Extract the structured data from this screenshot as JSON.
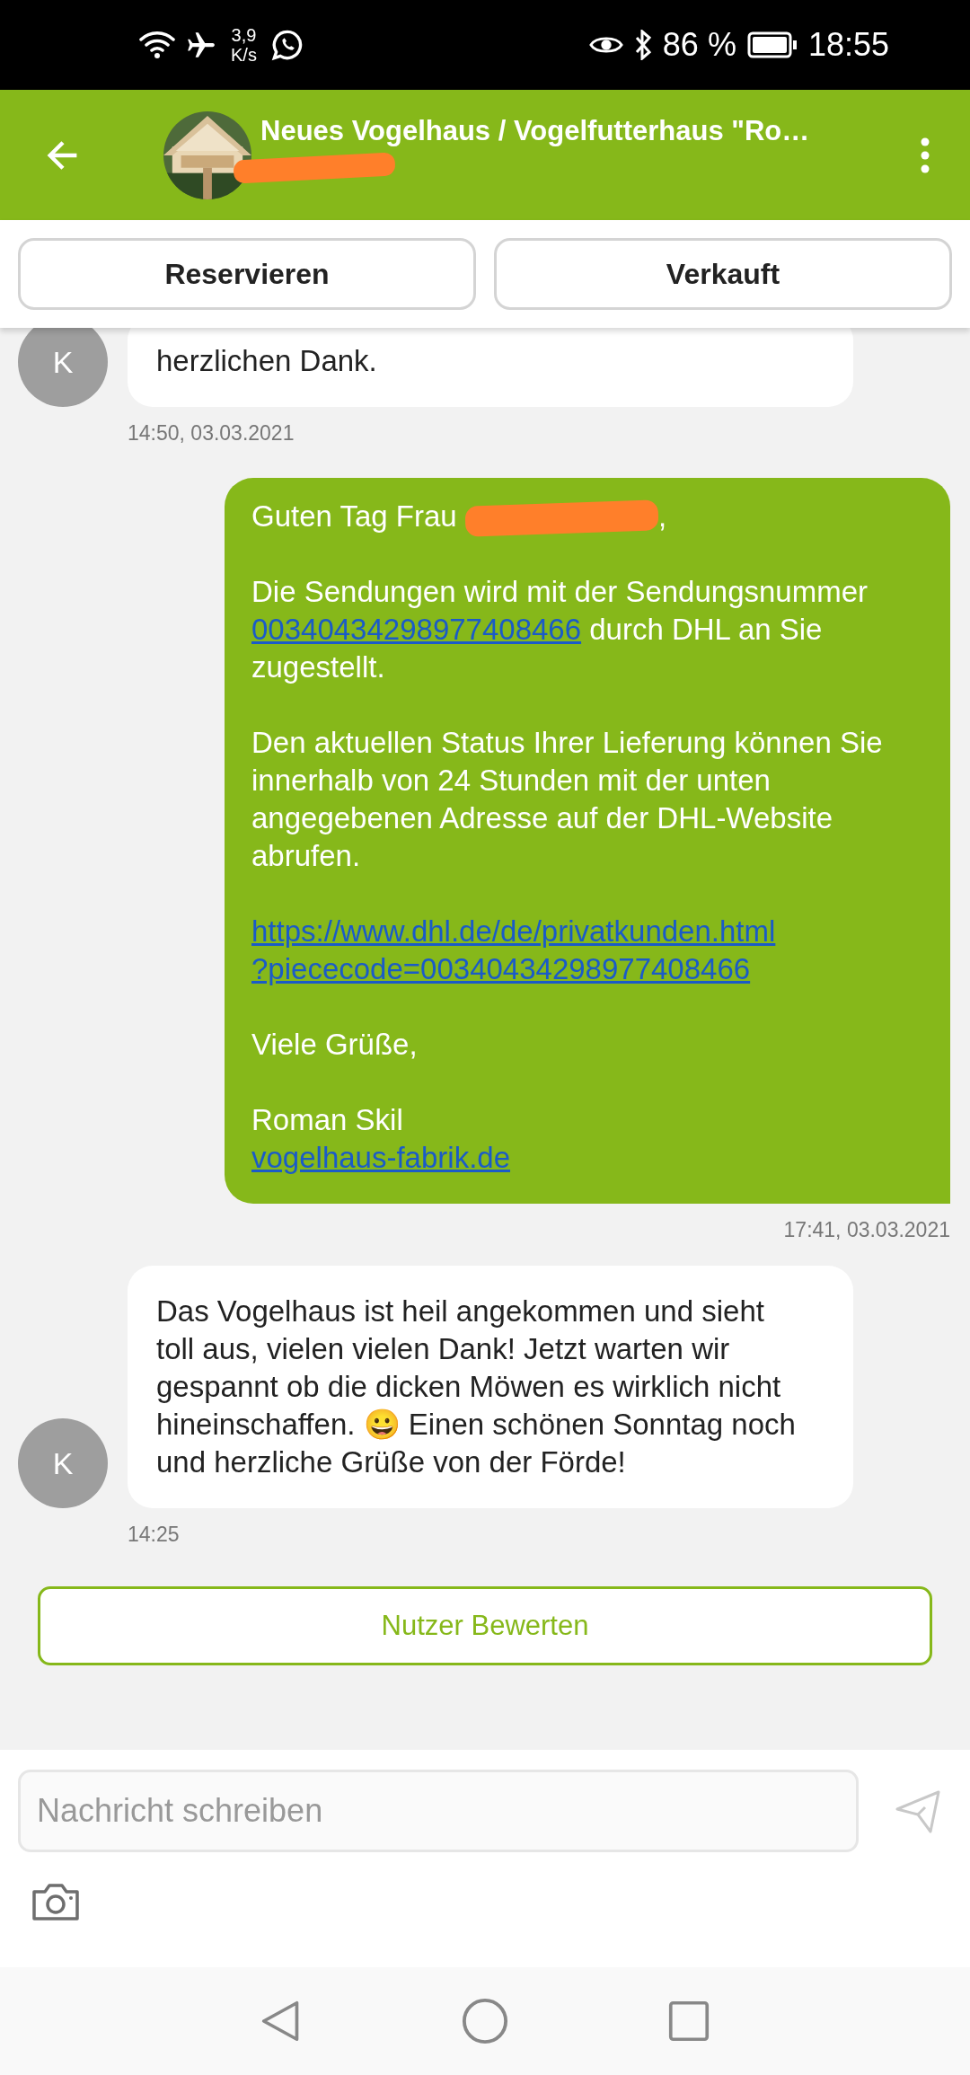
{
  "status_bar": {
    "net_speed_value": "3,9",
    "net_speed_unit": "K/s",
    "battery": "86 %",
    "time": "18:55"
  },
  "header": {
    "title": "Neues Vogelhaus / Vogelfutterhaus \"Ro…",
    "subtitle_redacted": true
  },
  "actions": [
    "Reservieren",
    "Verkauft"
  ],
  "messages": [
    {
      "kind": "incoming",
      "avatar": "K",
      "time": "14:50, 03.03.2021",
      "paragraphs": [
        [
          [
            {
              "text": "herzlichen Dank."
            }
          ]
        ]
      ]
    },
    {
      "kind": "outgoing",
      "time": "17:41, 03.03.2021",
      "paragraphs": [
        [
          [
            {
              "text": "Guten Tag Frau "
            },
            {
              "redacted": true
            },
            {
              "text": ","
            }
          ]
        ],
        [
          [
            {
              "text": "Die Sendungen wird mit der Sendungsnummer "
            },
            {
              "text": "00340434298977408466",
              "link": true
            },
            {
              "text": " durch DHL an Sie zugestellt."
            }
          ]
        ],
        [
          [
            {
              "text": "Den aktuellen Status Ihrer Lieferung können Sie innerhalb von 24 Stunden mit der unten angegebenen Adresse auf der DHL-Website abrufen."
            }
          ]
        ],
        [
          [
            {
              "text": "https://www.dhl.de/de/privatkunden.html",
              "link": true
            }
          ],
          [
            {
              "text": "?piececode=00340434298977408466",
              "link": true
            }
          ]
        ],
        [
          [
            {
              "text": "Viele Grüße,"
            }
          ]
        ],
        [
          [
            {
              "text": "Roman Skil"
            }
          ],
          [
            {
              "text": "vogelhaus-fabrik.de",
              "link": true
            }
          ]
        ]
      ]
    },
    {
      "kind": "incoming",
      "avatar": "K",
      "time": "14:25",
      "paragraphs": [
        [
          [
            {
              "text": "Das Vogelhaus ist heil angekommen und sieht toll aus, vielen vielen Dank! Jetzt warten wir gespannt ob die dicken Möwen es wirklich nicht hineinschaffen. 😀 Einen schönen Sonntag noch und herzliche Grüße von der Förde!"
            }
          ]
        ]
      ]
    }
  ],
  "rate_button": "Nutzer Bewerten",
  "composer": {
    "placeholder": "Nachricht schreiben"
  }
}
